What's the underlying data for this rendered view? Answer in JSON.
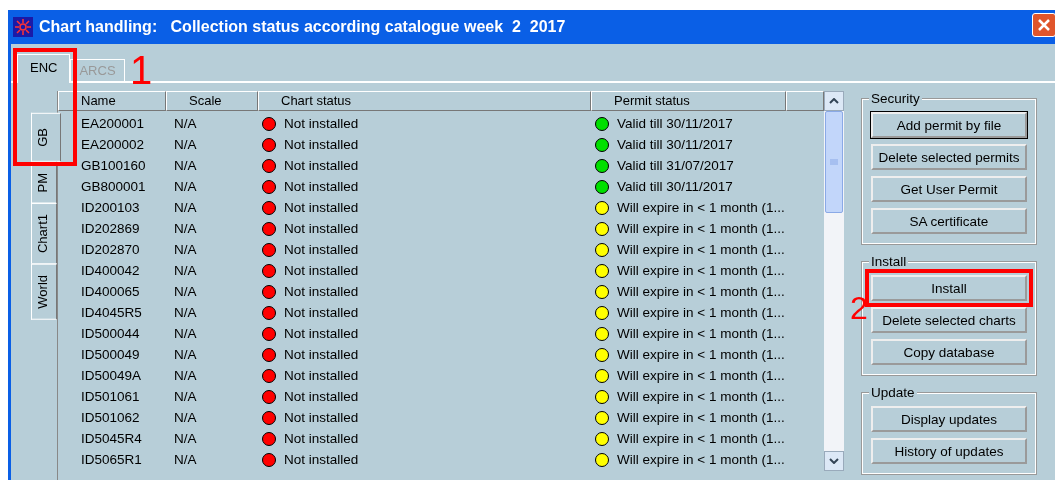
{
  "window": {
    "title": "Chart handling:   Collection status according catalogue week  2  2017"
  },
  "tabs": [
    {
      "label": "ENC",
      "selected": true
    },
    {
      "label": "ARCS",
      "selected": false
    }
  ],
  "side_tabs": [
    {
      "label": "GB",
      "selected": true
    },
    {
      "label": "PM",
      "selected": false
    },
    {
      "label": "Chart1",
      "selected": false
    },
    {
      "label": "World",
      "selected": false
    }
  ],
  "table": {
    "columns": [
      "Name",
      "Scale",
      "Chart status",
      "Permit status"
    ],
    "rows": [
      {
        "name": "EA200001",
        "scale": "N/A",
        "chart_status": {
          "text": "Not installed",
          "color": "#ff0000"
        },
        "permit_status": {
          "text": "Valid till 30/11/2017",
          "color": "#00e000"
        }
      },
      {
        "name": "EA200002",
        "scale": "N/A",
        "chart_status": {
          "text": "Not installed",
          "color": "#ff0000"
        },
        "permit_status": {
          "text": "Valid till 30/11/2017",
          "color": "#00e000"
        }
      },
      {
        "name": "GB100160",
        "scale": "N/A",
        "chart_status": {
          "text": "Not installed",
          "color": "#ff0000"
        },
        "permit_status": {
          "text": "Valid till 31/07/2017",
          "color": "#00e000"
        }
      },
      {
        "name": "GB800001",
        "scale": "N/A",
        "chart_status": {
          "text": "Not installed",
          "color": "#ff0000"
        },
        "permit_status": {
          "text": "Valid till 30/11/2017",
          "color": "#00e000"
        }
      },
      {
        "name": "ID200103",
        "scale": "N/A",
        "chart_status": {
          "text": "Not installed",
          "color": "#ff0000"
        },
        "permit_status": {
          "text": "Will expire in < 1 month (1...",
          "color": "#ffff00"
        }
      },
      {
        "name": "ID202869",
        "scale": "N/A",
        "chart_status": {
          "text": "Not installed",
          "color": "#ff0000"
        },
        "permit_status": {
          "text": "Will expire in < 1 month (1...",
          "color": "#ffff00"
        }
      },
      {
        "name": "ID202870",
        "scale": "N/A",
        "chart_status": {
          "text": "Not installed",
          "color": "#ff0000"
        },
        "permit_status": {
          "text": "Will expire in < 1 month (1...",
          "color": "#ffff00"
        }
      },
      {
        "name": "ID400042",
        "scale": "N/A",
        "chart_status": {
          "text": "Not installed",
          "color": "#ff0000"
        },
        "permit_status": {
          "text": "Will expire in < 1 month (1...",
          "color": "#ffff00"
        }
      },
      {
        "name": "ID400065",
        "scale": "N/A",
        "chart_status": {
          "text": "Not installed",
          "color": "#ff0000"
        },
        "permit_status": {
          "text": "Will expire in < 1 month (1...",
          "color": "#ffff00"
        }
      },
      {
        "name": "ID4045R5",
        "scale": "N/A",
        "chart_status": {
          "text": "Not installed",
          "color": "#ff0000"
        },
        "permit_status": {
          "text": "Will expire in < 1 month (1...",
          "color": "#ffff00"
        }
      },
      {
        "name": "ID500044",
        "scale": "N/A",
        "chart_status": {
          "text": "Not installed",
          "color": "#ff0000"
        },
        "permit_status": {
          "text": "Will expire in < 1 month (1...",
          "color": "#ffff00"
        }
      },
      {
        "name": "ID500049",
        "scale": "N/A",
        "chart_status": {
          "text": "Not installed",
          "color": "#ff0000"
        },
        "permit_status": {
          "text": "Will expire in < 1 month (1...",
          "color": "#ffff00"
        }
      },
      {
        "name": "ID50049A",
        "scale": "N/A",
        "chart_status": {
          "text": "Not installed",
          "color": "#ff0000"
        },
        "permit_status": {
          "text": "Will expire in < 1 month (1...",
          "color": "#ffff00"
        }
      },
      {
        "name": "ID501061",
        "scale": "N/A",
        "chart_status": {
          "text": "Not installed",
          "color": "#ff0000"
        },
        "permit_status": {
          "text": "Will expire in < 1 month (1...",
          "color": "#ffff00"
        }
      },
      {
        "name": "ID501062",
        "scale": "N/A",
        "chart_status": {
          "text": "Not installed",
          "color": "#ff0000"
        },
        "permit_status": {
          "text": "Will expire in < 1 month (1...",
          "color": "#ffff00"
        }
      },
      {
        "name": "ID5045R4",
        "scale": "N/A",
        "chart_status": {
          "text": "Not installed",
          "color": "#ff0000"
        },
        "permit_status": {
          "text": "Will expire in < 1 month (1...",
          "color": "#ffff00"
        }
      },
      {
        "name": "ID5065R1",
        "scale": "N/A",
        "chart_status": {
          "text": "Not installed",
          "color": "#ff0000"
        },
        "permit_status": {
          "text": "Will expire in < 1 month (1...",
          "color": "#ffff00"
        }
      }
    ]
  },
  "groups": [
    {
      "title": "Security",
      "buttons": [
        {
          "label": "Add permit by file",
          "default": true
        },
        {
          "label": "Delete selected permits",
          "default": false
        },
        {
          "label": "Get User Permit",
          "default": false
        },
        {
          "label": "SA certificate",
          "default": false
        }
      ]
    },
    {
      "title": "Install",
      "buttons": [
        {
          "label": "Install",
          "default": false
        },
        {
          "label": "Delete selected charts",
          "default": false
        },
        {
          "label": "Copy database",
          "default": false
        }
      ]
    },
    {
      "title": "Update",
      "buttons": [
        {
          "label": "Display updates",
          "default": false
        },
        {
          "label": "History of updates",
          "default": false
        }
      ]
    }
  ],
  "annotations": [
    "1",
    "2"
  ]
}
